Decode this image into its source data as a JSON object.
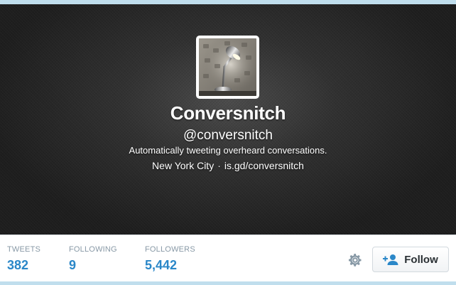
{
  "profile": {
    "name": "Conversnitch",
    "handle": "@conversnitch",
    "bio": "Automatically tweeting overheard conversations.",
    "location": "New York City",
    "separator": "·",
    "url": "is.gd/conversnitch"
  },
  "stats": {
    "tweets_label": "TWEETS",
    "tweets_value": "382",
    "following_label": "FOLLOWING",
    "following_value": "9",
    "followers_label": "FOLLOWERS",
    "followers_value": "5,442"
  },
  "actions": {
    "follow_label": "Follow",
    "settings_icon": "gear-icon",
    "follow_icon": "add-user-icon"
  },
  "colors": {
    "accent": "#2a87c8",
    "background": "#c0deed",
    "header": "#262626"
  }
}
